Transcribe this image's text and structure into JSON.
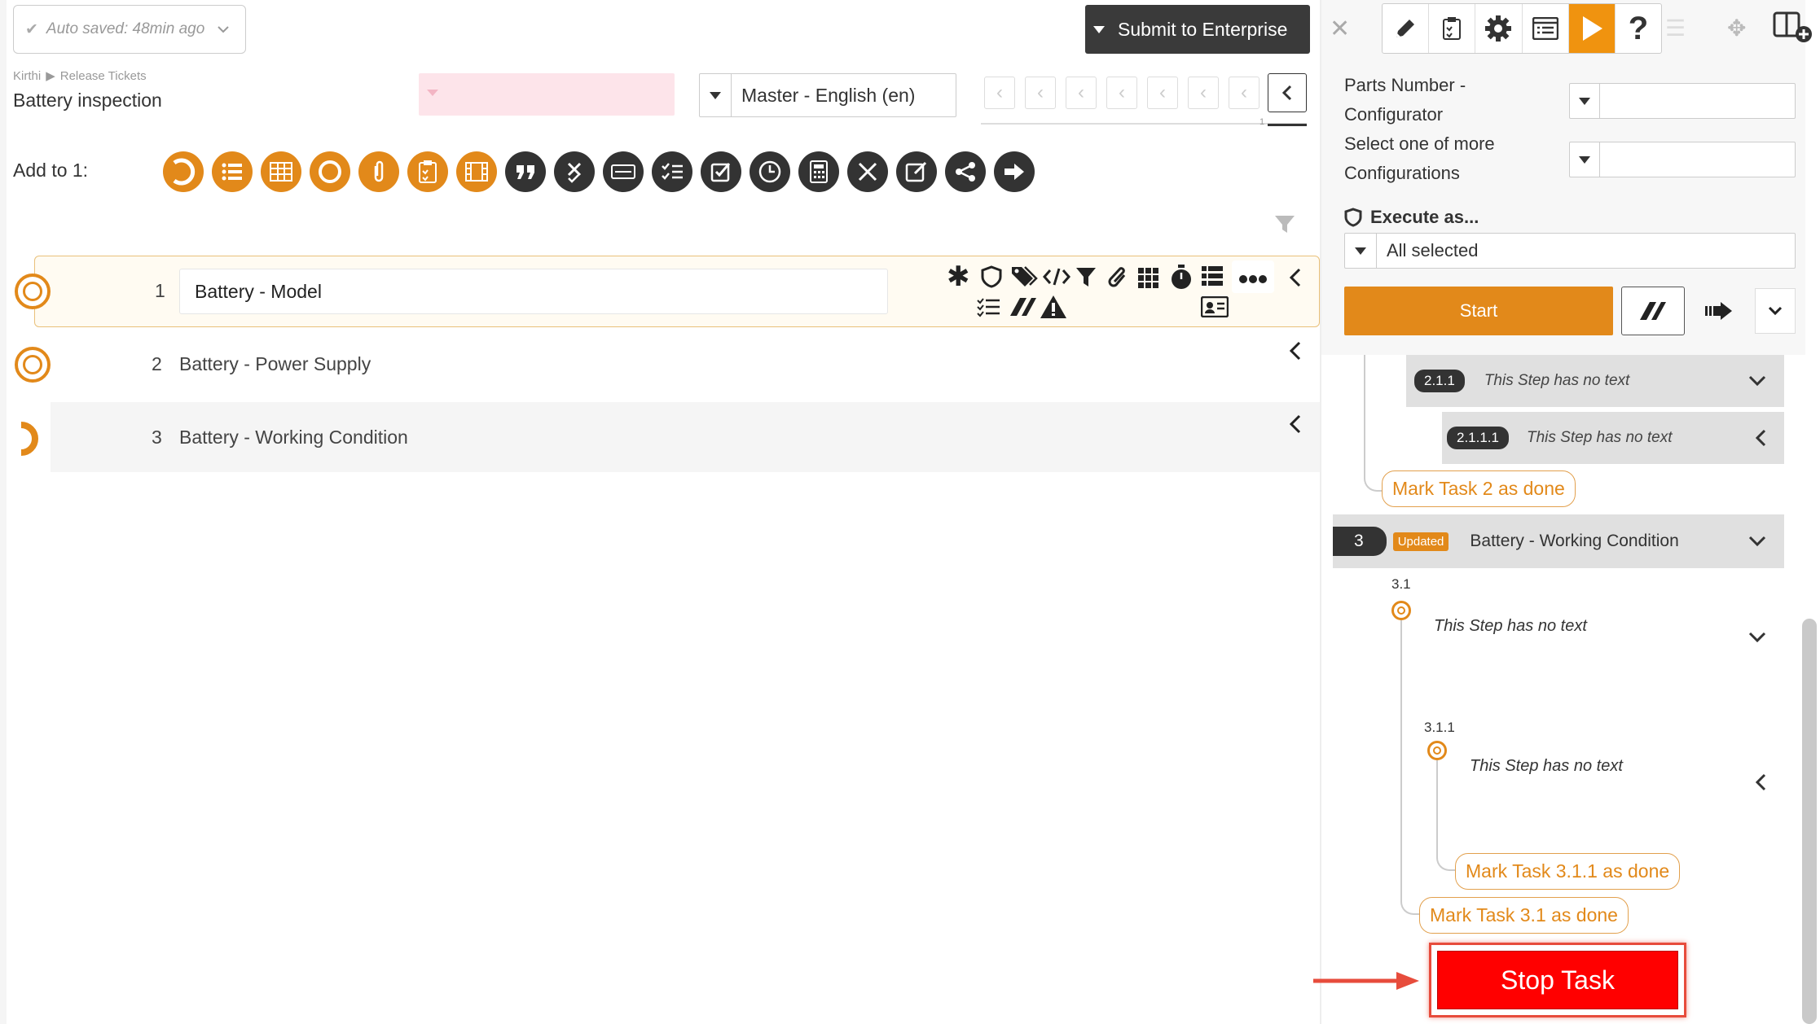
{
  "header": {
    "autosave": "Auto saved: 48min ago",
    "breadcrumb": [
      "Kirthi",
      "Release Tickets"
    ],
    "title": "Battery inspection",
    "language": "Master - English (en)",
    "submit_label": "Submit to Enterprise",
    "nav_page": "1"
  },
  "add_to": {
    "label": "Add to 1:",
    "tools": [
      "step-icon",
      "list-icon",
      "table-icon",
      "circle-icon",
      "attachment-icon",
      "clipboard-icon",
      "film-icon",
      "quote-icon",
      "cross-check-icon",
      "card-icon",
      "checklist-icon",
      "checkbox-icon",
      "clock-icon",
      "calculator-icon",
      "tools-icon",
      "edit-icon",
      "share-icon",
      "arrow-right-icon"
    ]
  },
  "tasks": [
    {
      "num": "1",
      "title": "Battery - Model"
    },
    {
      "num": "2",
      "title": "Battery - Power Supply"
    },
    {
      "num": "3",
      "title": "Battery - Working Condition"
    }
  ],
  "panel": {
    "parts_number_line1": "Parts Number -",
    "parts_number_line2": "Configurator",
    "select_line1": "Select one of more",
    "select_line2": "Configurations",
    "execute_label": "Execute as...",
    "execute_value": "All selected",
    "start_label": "Start",
    "step_211_num": "2.1.1",
    "step_211_text": "This Step has no text",
    "step_2111_num": "2.1.1.1",
    "step_2111_text": "This Step has no text",
    "mark_task2": "Mark Task 2 as done",
    "task3_num": "3",
    "task3_badge": "Updated",
    "task3_title": "Battery - Working Condition",
    "step_31_num": "3.1",
    "step_31_text": "This Step has no text",
    "step_311_num": "3.1.1",
    "step_311_text": "This Step has no text",
    "mark_311": "Mark Task 3.1.1 as done",
    "mark_31": "Mark Task 3.1 as done",
    "stop_label": "Stop Task"
  },
  "colors": {
    "accent": "#e2891a",
    "dark": "#333333",
    "stop": "#ff0000"
  }
}
